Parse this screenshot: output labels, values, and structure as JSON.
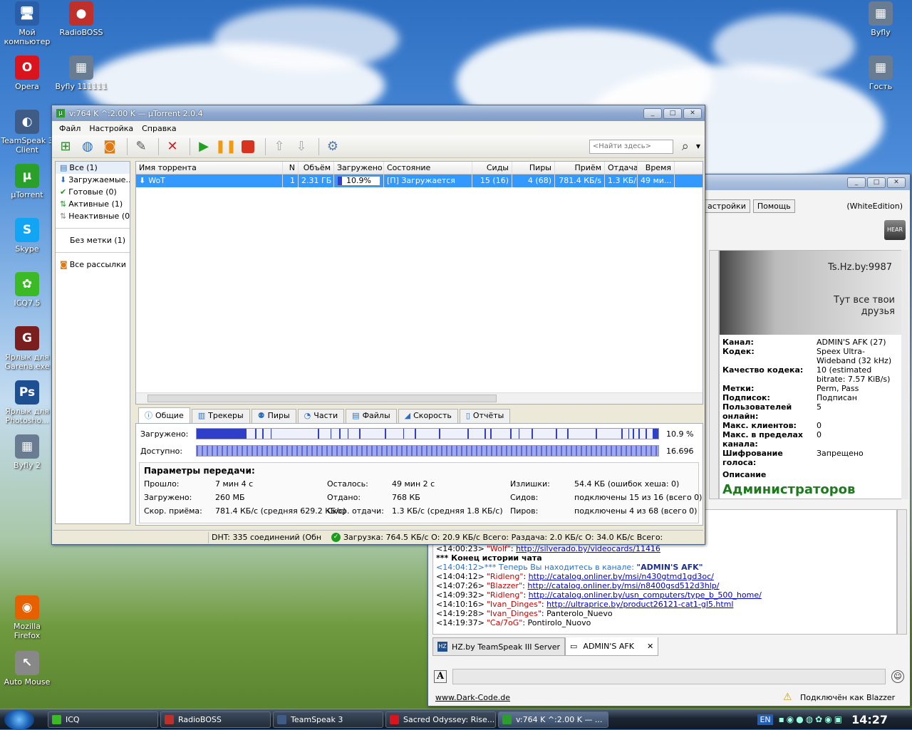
{
  "desktop": {
    "icons": [
      {
        "label": "Мой компьютер",
        "icon": "computer-icon",
        "color": "#2a5fa8",
        "glyph": "🖥"
      },
      {
        "label": "RadioBOSS",
        "icon": "radio-icon",
        "color": "#c0302a",
        "glyph": "●"
      },
      {
        "label": "Opera",
        "icon": "opera-icon",
        "color": "#d9141d",
        "glyph": "O"
      },
      {
        "label": "Byfly 111111",
        "icon": "network-icon",
        "color": "#6a7c92",
        "glyph": "▦"
      },
      {
        "label": "TeamSpeak 3 Client",
        "icon": "teamspeak-icon",
        "color": "#3f5c86",
        "glyph": "◐"
      },
      {
        "label": "µTorrent",
        "icon": "utorrent-icon",
        "color": "#2aa02a",
        "glyph": "µ"
      },
      {
        "label": "Skype",
        "icon": "skype-icon",
        "color": "#12a5f4",
        "glyph": "S"
      },
      {
        "label": "ICQ7.5",
        "icon": "icq-icon",
        "color": "#3cba26",
        "glyph": "✿"
      },
      {
        "label": "Ярлык для Garena.exe",
        "icon": "garena-icon",
        "color": "#7a1e1e",
        "glyph": "G"
      },
      {
        "label": "Ярлык для Photosho...",
        "icon": "photoshop-icon",
        "color": "#1d4f91",
        "glyph": "Ps"
      },
      {
        "label": "Byfly 2",
        "icon": "network-icon",
        "color": "#6a7c92",
        "glyph": "▦"
      },
      {
        "label": "Mozilla Firefox",
        "icon": "firefox-icon",
        "color": "#e66000",
        "glyph": "◉"
      },
      {
        "label": "Auto Mouse",
        "icon": "mouse-icon",
        "color": "#888888",
        "glyph": "↖"
      },
      {
        "label": "Byfly",
        "icon": "network-icon",
        "color": "#6a7c92",
        "glyph": "▦"
      },
      {
        "label": "Гость",
        "icon": "network-icon",
        "color": "#6a7c92",
        "glyph": "▦"
      }
    ]
  },
  "utorrent": {
    "title": "v:764 K ^:2.00 K — µTorrent 2.0.4",
    "menu": [
      "Файл",
      "Настройка",
      "Справка"
    ],
    "search_placeholder": "<Найти здесь>",
    "sidebar": [
      "Все (1)",
      "Загружаемые...",
      "Готовые (0)",
      "Активные (1)",
      "Неактивные (0)",
      "Без метки (1)",
      "Все рассылки"
    ],
    "columns": [
      "Имя торрента",
      "N",
      "Объём",
      "Загружено",
      "Состояние",
      "Сиды",
      "Пиры",
      "Приём",
      "Отдача",
      "Время"
    ],
    "row": {
      "name": "WoT",
      "n": "1",
      "size": "2.31 ГБ",
      "done": "10.9%",
      "done_fraction": 0.109,
      "status": "[П] Загружается",
      "seeds": "15 (16)",
      "peers": "4 (68)",
      "down": "781.4 КБ/s",
      "up": "1.3 КБ/s",
      "eta": "49 ми..."
    },
    "tabs": [
      "Общие",
      "Трекеры",
      "Пиры",
      "Части",
      "Файлы",
      "Скорость",
      "Отчёты"
    ],
    "downloaded_label": "Загружено:",
    "downloaded_val": "10.9 %",
    "available_label": "Доступно:",
    "available_val": "16.696",
    "params_title": "Параметры передачи:",
    "params": [
      [
        "Прошло:",
        "7 мин 4 с",
        "Осталось:",
        "49 мин 2 с",
        "Излишки:",
        "54.4 КБ (ошибок хеша: 0)"
      ],
      [
        "Загружено:",
        "260 МБ",
        "Отдано:",
        "768 КБ",
        "Сидов:",
        "подключены 15 из 16 (всего 0)"
      ],
      [
        "Скор. приёма:",
        "781.4 КБ/с (средняя 629.2 КБ/с)",
        "Скор. отдачи:",
        "1.3 КБ/с (средняя 1.8 КБ/с)",
        "Пиров:",
        "подключены 4 из 68 (всего 0)"
      ]
    ],
    "status_dht": "DHT: 335 соединений  (Обн",
    "status_transfer": "Загрузка: 764.5 КБ/с О: 20.9 КБ/с Всего:  Раздача: 2.0 КБ/с О: 34.0 КБ/с Всего:"
  },
  "teamspeak": {
    "btn_settings": "астройки",
    "btn_help": "Помощь",
    "edition": "(WhiteEdition)",
    "banner_line1": "Ts.Hz.by:9987",
    "banner_line2": "Тут все твои",
    "banner_line3": "друзья",
    "info": [
      [
        "Канал:",
        "ADMIN'S AFK (27)"
      ],
      [
        "Кодек:",
        "Speex Ultra-Wideband (32 kHz)"
      ],
      [
        "Качество кодека:",
        "10 (estimated bitrate: 7.57 KiB/s)"
      ],
      [
        "Метки:",
        "Perm, Pass"
      ],
      [
        "Подписок:",
        "Подписан"
      ],
      [
        "Пользователей онлайн:",
        "5"
      ],
      [
        "Макс. клиентов:",
        "0"
      ],
      [
        "Макс. в пределах канала:",
        "0"
      ],
      [
        "Шифрование голоса:",
        "Запрещено"
      ]
    ],
    "desc_label": "Описание",
    "desc_big": "Администраторов",
    "chat": [
      {
        "t": "<14:00:23>",
        "nick": "\"Wolf\"",
        "link": "http://silverado.by/videocards/11416"
      },
      {
        "sys": "*** Конец истории чата"
      },
      {
        "t": "<14:04:12>",
        "info": "*** Теперь Вы находитесь в канале: ",
        "chan": "\"ADMIN'S AFK\""
      },
      {
        "t": "<14:04:12>",
        "nick": "\"Ridleng\"",
        "link": "http://catalog.onliner.by/msi/n430gtmd1gd3oc/"
      },
      {
        "t": "<14:07:26>",
        "nick": "\"Blazzer\"",
        "link": "http://catalog.onliner.by/msi/n8400gsd512d3hlp/"
      },
      {
        "t": "<14:09:32>",
        "nick": "\"Ridleng\"",
        "link": "http://catalog.onliner.by/usn_computers/type_b_500_home/"
      },
      {
        "t": "<14:10:16>",
        "nick": "\"Ivan_Dinges\"",
        "link": "http://ultraprice.by/product26121-cat1-gl5.html"
      },
      {
        "t": "<14:19:28>",
        "nick": "\"Ivan_Dinges\"",
        "text": "Panterolo_Nuevo"
      },
      {
        "t": "<14:19:37>",
        "nick": "\"Ca/7oG\"",
        "text": "Pontirolo_Nuovo"
      }
    ],
    "tab_server": "HZ.by TeamSpeak III Server",
    "tab_channel": "ADMIN'S AFK",
    "footer_link": "www.Dark-Code.de",
    "footer_status": "Подключён как Blazzer"
  },
  "taskbar": {
    "tasks": [
      {
        "label": "ICQ",
        "color": "#3cba26"
      },
      {
        "label": "RadioBOSS",
        "color": "#c0302a"
      },
      {
        "label": "TeamSpeak 3",
        "color": "#3f5c86"
      },
      {
        "label": "Sacred Odyssey: Rise...",
        "color": "#d9141d"
      },
      {
        "label": "v:764 K ^:2.00 K — ...",
        "color": "#2aa02a"
      }
    ],
    "lang": "EN",
    "clock": "14:27"
  }
}
